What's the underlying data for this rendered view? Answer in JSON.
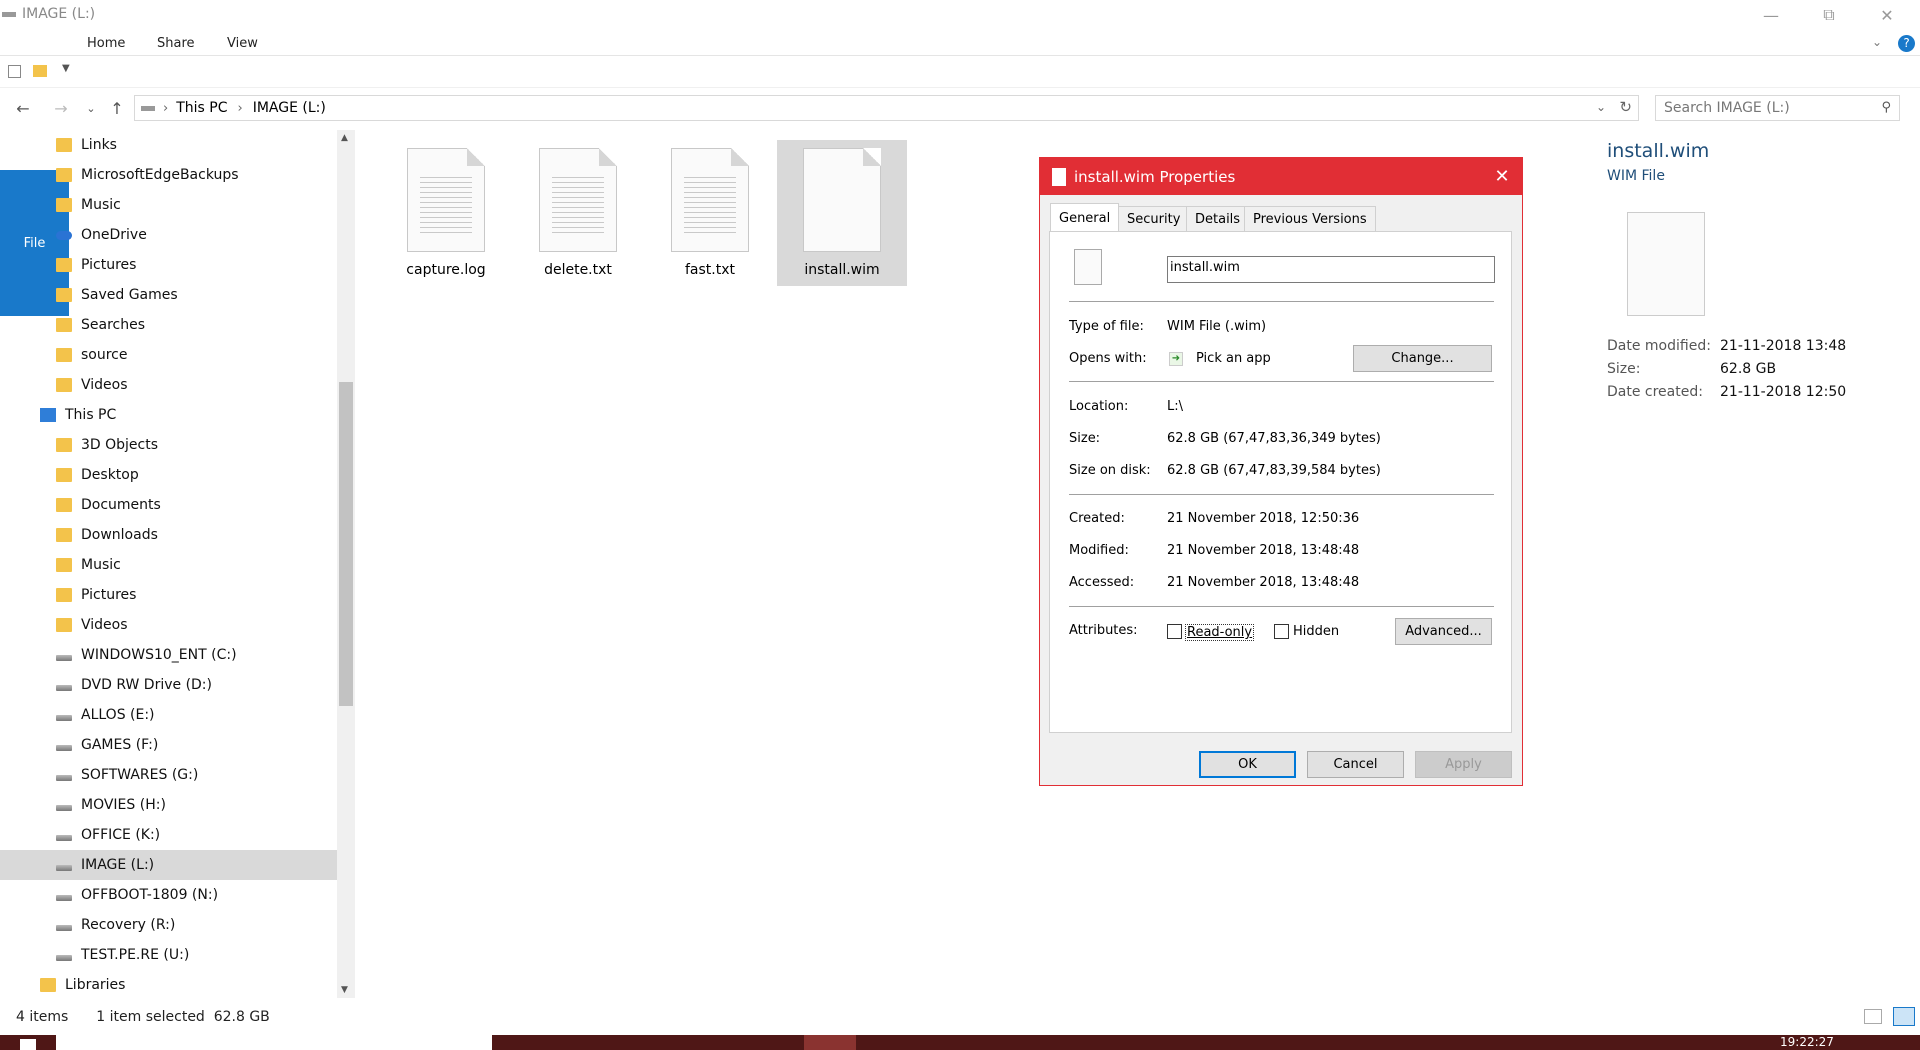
{
  "window": {
    "title": "IMAGE (L:)"
  },
  "ribbon": {
    "tabs": [
      "File",
      "Home",
      "Share",
      "View"
    ]
  },
  "address": {
    "segments": [
      "This PC",
      "IMAGE (L:)"
    ],
    "search_placeholder": "Search IMAGE (L:)"
  },
  "nav": {
    "items": [
      {
        "label": "Links",
        "icon": "folder-icon"
      },
      {
        "label": "MicrosoftEdgeBackups",
        "icon": "folder-icon"
      },
      {
        "label": "Music",
        "icon": "music-folder-icon"
      },
      {
        "label": "OneDrive",
        "icon": "cloud-icon"
      },
      {
        "label": "Pictures",
        "icon": "folder-icon"
      },
      {
        "label": "Saved Games",
        "icon": "folder-icon"
      },
      {
        "label": "Searches",
        "icon": "folder-icon"
      },
      {
        "label": "source",
        "icon": "folder-icon"
      },
      {
        "label": "Videos",
        "icon": "folder-icon"
      },
      {
        "label": "This PC",
        "icon": "pc-icon"
      },
      {
        "label": "3D Objects",
        "icon": "folder-icon"
      },
      {
        "label": "Desktop",
        "icon": "folder-icon"
      },
      {
        "label": "Documents",
        "icon": "folder-icon"
      },
      {
        "label": "Downloads",
        "icon": "folder-icon"
      },
      {
        "label": "Music",
        "icon": "folder-icon"
      },
      {
        "label": "Pictures",
        "icon": "folder-icon"
      },
      {
        "label": "Videos",
        "icon": "folder-icon"
      },
      {
        "label": "WINDOWS10_ENT (C:)",
        "icon": "drive-icon"
      },
      {
        "label": "DVD RW Drive (D:)",
        "icon": "drive-icon"
      },
      {
        "label": "ALLOS (E:)",
        "icon": "drive-icon"
      },
      {
        "label": "GAMES (F:)",
        "icon": "drive-icon"
      },
      {
        "label": "SOFTWARES (G:)",
        "icon": "drive-icon"
      },
      {
        "label": "MOVIES (H:)",
        "icon": "drive-icon"
      },
      {
        "label": "OFFICE (K:)",
        "icon": "drive-icon"
      },
      {
        "label": "IMAGE (L:)",
        "icon": "drive-icon"
      },
      {
        "label": "OFFBOOT-1809 (N:)",
        "icon": "drive-icon"
      },
      {
        "label": "Recovery (R:)",
        "icon": "drive-icon"
      },
      {
        "label": "TEST.PE.RE (U:)",
        "icon": "drive-icon"
      },
      {
        "label": "Libraries",
        "icon": "folder-icon"
      }
    ],
    "selected": "IMAGE (L:)"
  },
  "files": [
    {
      "name": "capture.log"
    },
    {
      "name": "delete.txt"
    },
    {
      "name": "fast.txt"
    },
    {
      "name": "install.wim"
    }
  ],
  "details": {
    "name": "install.wim",
    "type": "WIM File",
    "rows": [
      {
        "label": "Date modified:",
        "value": "21-11-2018 13:48"
      },
      {
        "label": "Size:",
        "value": "62.8 GB"
      },
      {
        "label": "Date created:",
        "value": "21-11-2018 12:50"
      }
    ]
  },
  "dialog": {
    "title": "install.wim Properties",
    "tabs": [
      "General",
      "Security",
      "Details",
      "Previous Versions"
    ],
    "filename": "install.wim",
    "type_label": "Type of file:",
    "type_value": "WIM File (.wim)",
    "opens_label": "Opens with:",
    "opens_value": "Pick an app",
    "change_btn": "Change...",
    "location_label": "Location:",
    "location_value": "L:\\",
    "size_label": "Size:",
    "size_value": "62.8 GB (67,47,83,36,349 bytes)",
    "sod_label": "Size on disk:",
    "sod_value": "62.8 GB (67,47,83,39,584 bytes)",
    "created_label": "Created:",
    "created_value": "21 November 2018, 12:50:36",
    "modified_label": "Modified:",
    "modified_value": "21 November 2018, 13:48:48",
    "accessed_label": "Accessed:",
    "accessed_value": "21 November 2018, 13:48:48",
    "attributes_label": "Attributes:",
    "readonly": "Read-only",
    "hidden": "Hidden",
    "advanced_btn": "Advanced...",
    "ok": "OK",
    "cancel": "Cancel",
    "apply": "Apply"
  },
  "status": {
    "count": "4 items",
    "selection": "1 item selected  62.8 GB"
  },
  "taskbar": {
    "clock": "19:22:27"
  },
  "colors": {
    "accent": "#1979ca",
    "dialog_title": "#e12e35",
    "taskbar": "#4f1716"
  }
}
